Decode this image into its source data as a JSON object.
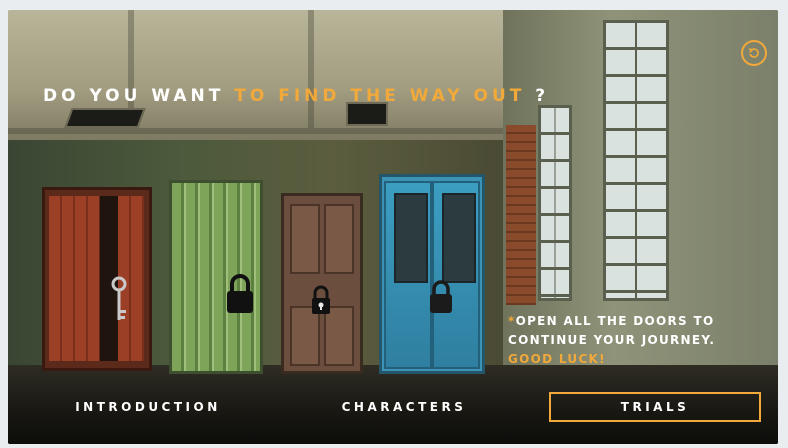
{
  "headline": {
    "part1": "DO YOU WANT ",
    "accent": "TO FIND THE WAY OUT",
    "part2": " ?"
  },
  "note": {
    "star": "*",
    "line1": "OPEN ALL THE DOORS TO",
    "line2": "CONTINUE YOUR JOURNEY.",
    "luck": "GOOD LUCK!"
  },
  "menu": [
    {
      "label": "INTRODUCTION",
      "active": false
    },
    {
      "label": "CHARACTERS",
      "active": false
    },
    {
      "label": "TRIALS",
      "active": true
    }
  ],
  "icons": {
    "back": "back-arrow-icon",
    "key": "key-icon",
    "lock_locked": "padlock-locked-icon",
    "lock_open": "padlock-open-icon"
  },
  "colors": {
    "accent": "#f0a93a",
    "text": "#ffffff"
  }
}
